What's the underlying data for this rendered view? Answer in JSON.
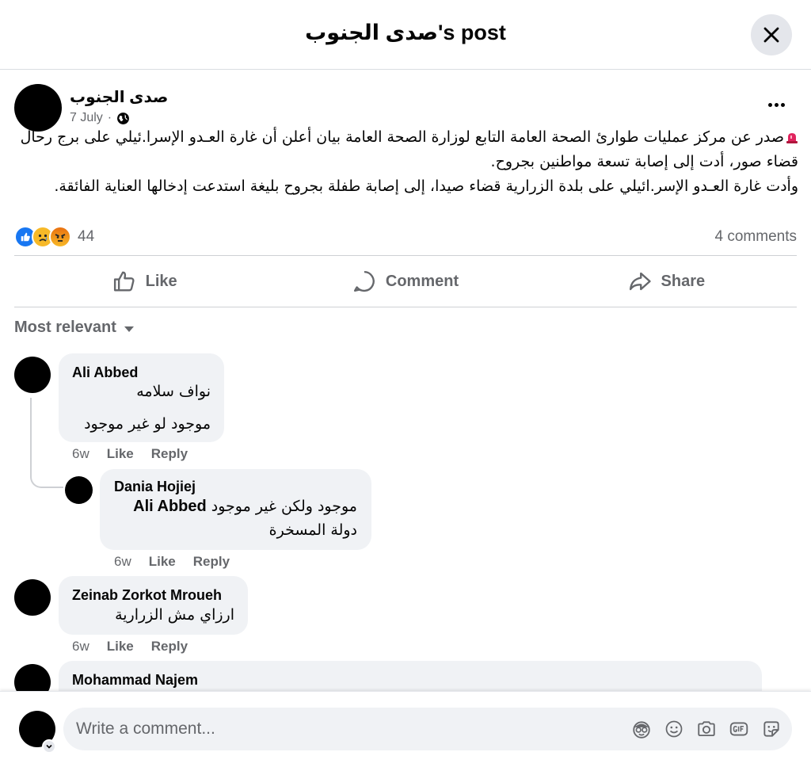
{
  "header": {
    "title": "صدى الجنوب's post"
  },
  "post": {
    "page_name": "صدى الجنوب",
    "date": "7 July",
    "separator": "·",
    "body_line1": "صدر عن مركز عمليات طوارئ الصحة العامة التابع لوزارة الصحة العامة بيان أعلن أن غارة العـدو الإسرا.ئيلي على برج رحال قضاء صور، أدت إلى إصابة تسعة مواطنين بجروح.",
    "body_line2": "وأدت غارة العـدو الإسر.ائيلي على بلدة الزرارية قضاء صيدا، إلى إصابة طفلة بجروح بليغة استدعت إدخالها العناية الفائقة.",
    "reaction_count": "44",
    "comments_count": "4 comments",
    "reaction_icons": [
      "like-icon",
      "sad-icon",
      "angry-icon"
    ]
  },
  "actions": {
    "like": "Like",
    "comment": "Comment",
    "share": "Share"
  },
  "sort_label": "Most relevant",
  "comments": [
    {
      "name": "Ali Abbed",
      "line1": "نواف سلامه",
      "line2": "موجود لو غير موجود",
      "time": "6w",
      "like": "Like",
      "reply": "Reply"
    },
    {
      "name": "Dania Hojiej",
      "mention": "Ali Abbed",
      "line1": "موجود ولكن غير موجود",
      "line2": "دولة المسخرة",
      "time": "6w",
      "like": "Like",
      "reply": "Reply"
    },
    {
      "name": "Zeinab Zorkot Mroueh",
      "line1": "ارزاي مش الزرارية",
      "time": "6w",
      "like": "Like",
      "reply": "Reply"
    },
    {
      "name": "Mohammad Najem"
    }
  ],
  "composer": {
    "placeholder": "Write a comment..."
  },
  "colors": {
    "like_blue": "#1877f2",
    "reaction_yellow": "#f7b928",
    "angry_orange": "#e9710f",
    "secondary_text": "#65676b",
    "bubble_bg": "#f0f2f5"
  }
}
